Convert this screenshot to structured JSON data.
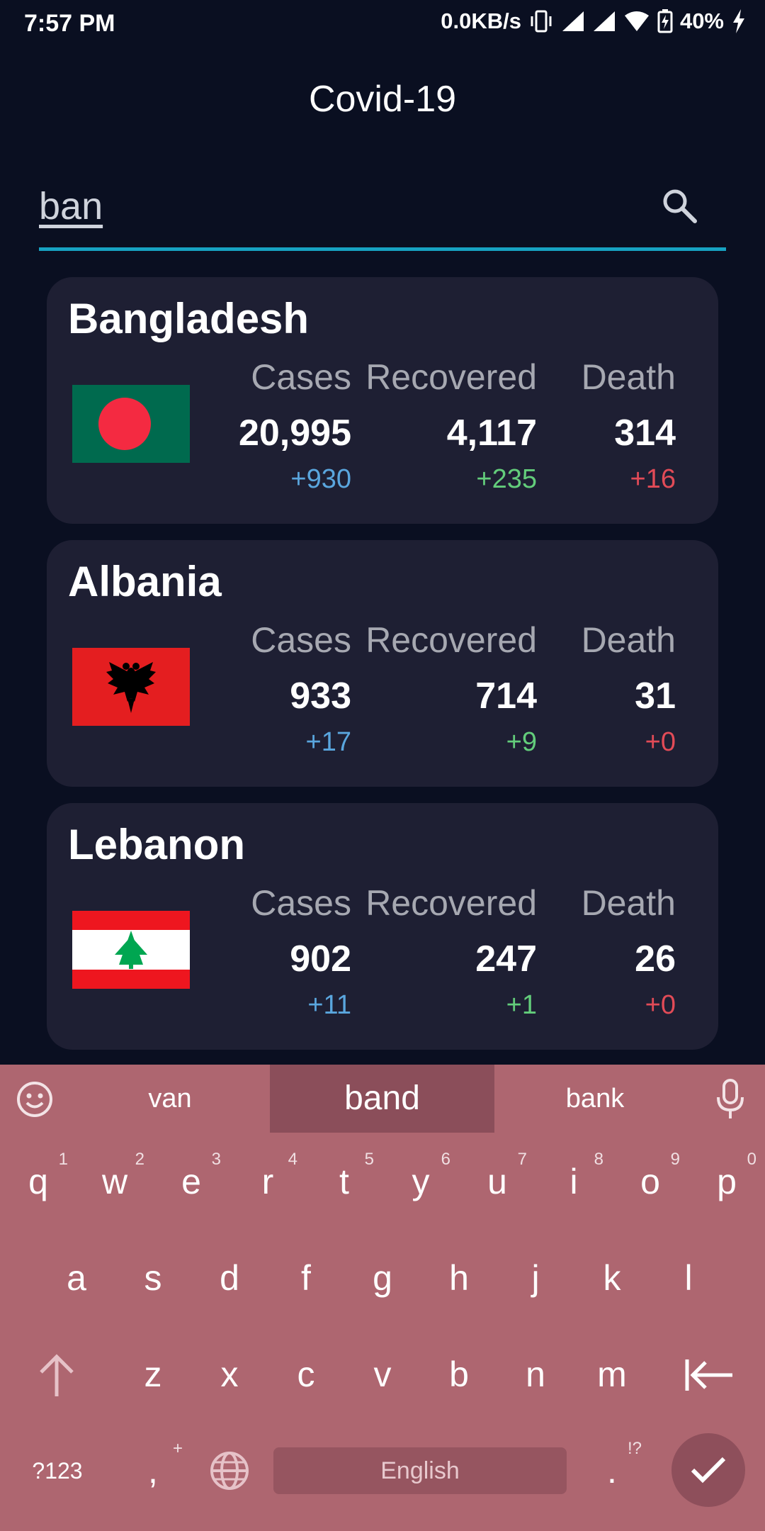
{
  "status_bar": {
    "time": "7:57 PM",
    "net_speed": "0.0KB/s",
    "battery": "40%"
  },
  "app": {
    "title": "Covid-19"
  },
  "search": {
    "value": "ban",
    "accent_color": "#17a2c2"
  },
  "labels": {
    "cases": "Cases",
    "recovered": "Recovered",
    "death": "Death"
  },
  "countries": [
    {
      "name": "Bangladesh",
      "flag": "bangladesh-flag",
      "cases": "20,995",
      "cases_delta": "+930",
      "recovered": "4,117",
      "recovered_delta": "+235",
      "death": "314",
      "death_delta": "+16"
    },
    {
      "name": "Albania",
      "flag": "albania-flag",
      "cases": "933",
      "cases_delta": "+17",
      "recovered": "714",
      "recovered_delta": "+9",
      "death": "31",
      "death_delta": "+0"
    },
    {
      "name": "Lebanon",
      "flag": "lebanon-flag",
      "cases": "902",
      "cases_delta": "+11",
      "recovered": "247",
      "recovered_delta": "+1",
      "death": "26",
      "death_delta": "+0"
    }
  ],
  "colors": {
    "cases_delta": "#5aa6de",
    "recovered_delta": "#63cd7b",
    "death_delta": "#e24b57",
    "card_bg": "#1e1f33",
    "keyboard_bg": "#ae6670"
  },
  "keyboard": {
    "suggestions": [
      "van",
      "band",
      "bank"
    ],
    "row1": [
      "q",
      "w",
      "e",
      "r",
      "t",
      "y",
      "u",
      "i",
      "o",
      "p"
    ],
    "row1_hints": [
      "1",
      "2",
      "3",
      "4",
      "5",
      "6",
      "7",
      "8",
      "9",
      "0"
    ],
    "row2": [
      "a",
      "s",
      "d",
      "f",
      "g",
      "h",
      "j",
      "k",
      "l"
    ],
    "row3": [
      "z",
      "x",
      "c",
      "v",
      "b",
      "n",
      "m"
    ],
    "symbols_key": "?123",
    "comma_key": ",",
    "comma_hint": "+",
    "space_label": "English",
    "period_key": ".",
    "period_hint": "!?"
  }
}
